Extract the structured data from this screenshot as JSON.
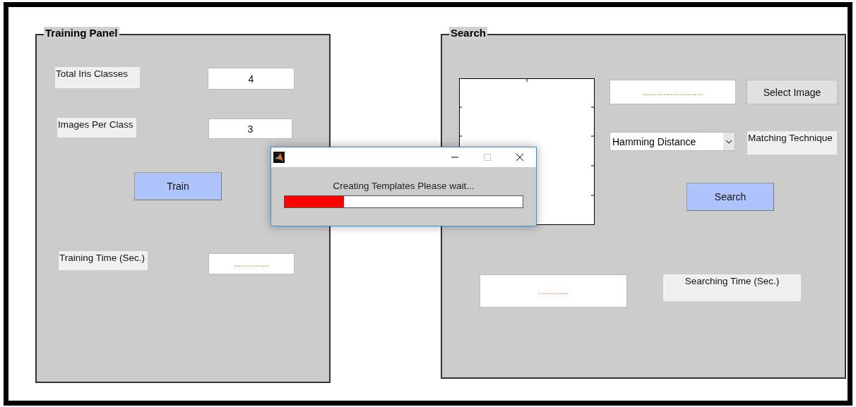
{
  "training_panel": {
    "title": "Training Panel",
    "fields": [
      {
        "label": "Total Iris Classes",
        "value": "4"
      },
      {
        "label": "Images Per Class",
        "value": "3"
      },
      {
        "label": "Training Time (Sec.)",
        "value": "..............."
      }
    ],
    "train_button": "Train"
  },
  "search_panel": {
    "title": "Search",
    "image_path_field": {
      "value": ".........................."
    },
    "select_button": "Select Image",
    "technique_dropdown": {
      "value": "Hamming Distance"
    },
    "technique_label": "Matching Technique",
    "search_button": "Search",
    "time_field": {
      "value": "............."
    },
    "time_label": "Searching Time (Sec.)"
  },
  "dialog": {
    "message": "Creating Templates Please wait...",
    "progress": {
      "level": 0.25
    }
  }
}
